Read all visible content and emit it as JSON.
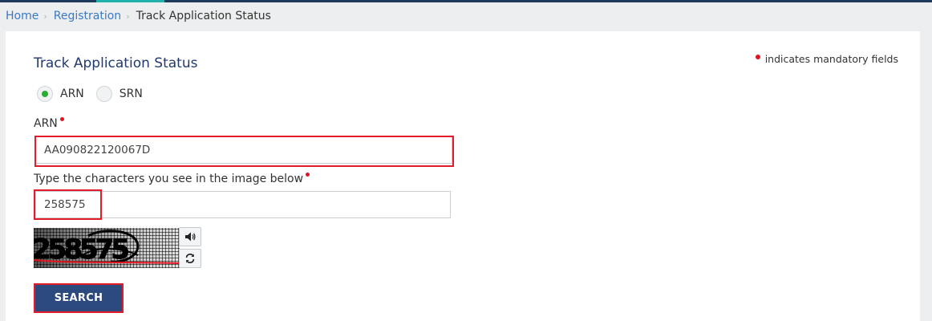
{
  "breadcrumb": {
    "home": "Home",
    "registration": "Registration",
    "current": "Track Application Status"
  },
  "form": {
    "title": "Track Application Status",
    "mandatory_note": "indicates mandatory fields",
    "radio_options": [
      {
        "label": "ARN",
        "checked": true
      },
      {
        "label": "SRN",
        "checked": false
      }
    ],
    "arn_label": "ARN",
    "arn_value": "AA090822120067D",
    "captcha_label": "Type the characters you see in the image below",
    "captcha_value": "258575",
    "captcha_image_text": "258575",
    "search_label": "SEARCH"
  },
  "colors": {
    "accent_blue": "#2c4a7e",
    "title_blue": "#223a6b",
    "link_blue": "#3a79c4",
    "required_red": "#e0131f",
    "highlight_red": "#e31b2a",
    "radio_green": "#2bab32"
  },
  "icons": [
    "speaker-icon",
    "refresh-icon"
  ]
}
